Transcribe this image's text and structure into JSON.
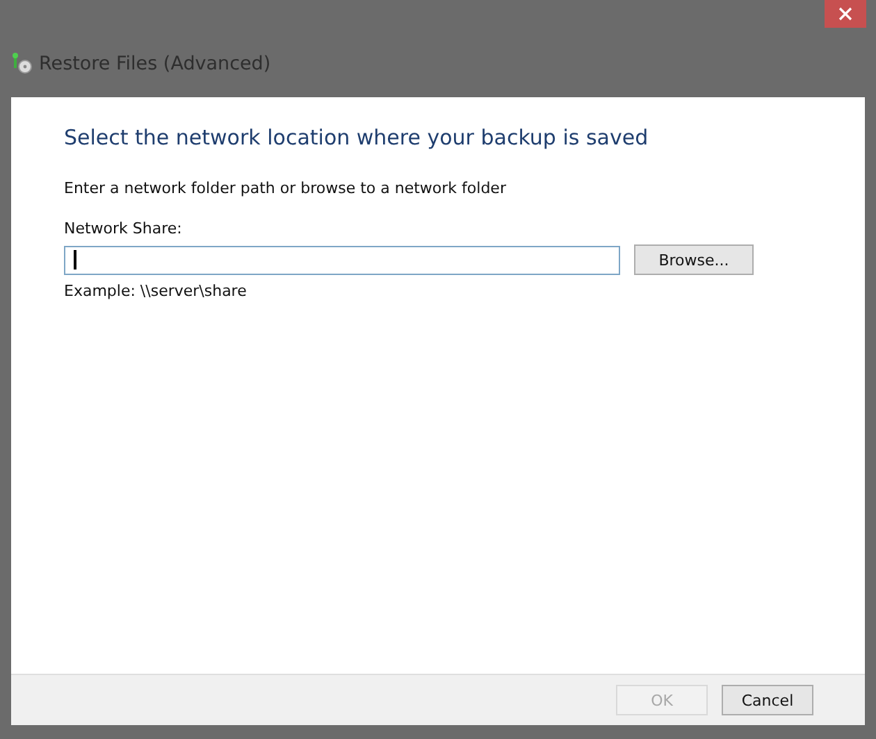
{
  "window": {
    "title": "Restore Files (Advanced)"
  },
  "heading": "Select the network location where your backup is saved",
  "instruction": "Enter a network folder path or browse to a network folder",
  "network_share": {
    "label": "Network Share:",
    "focused": true
  },
  "browse_button": {
    "label": "Browse...",
    "disabled": false
  },
  "example": "Example: \\\\server\\share",
  "buttons": [
    {
      "label": "OK",
      "disabled": true
    },
    {
      "label": "Cancel",
      "disabled": false
    }
  ]
}
